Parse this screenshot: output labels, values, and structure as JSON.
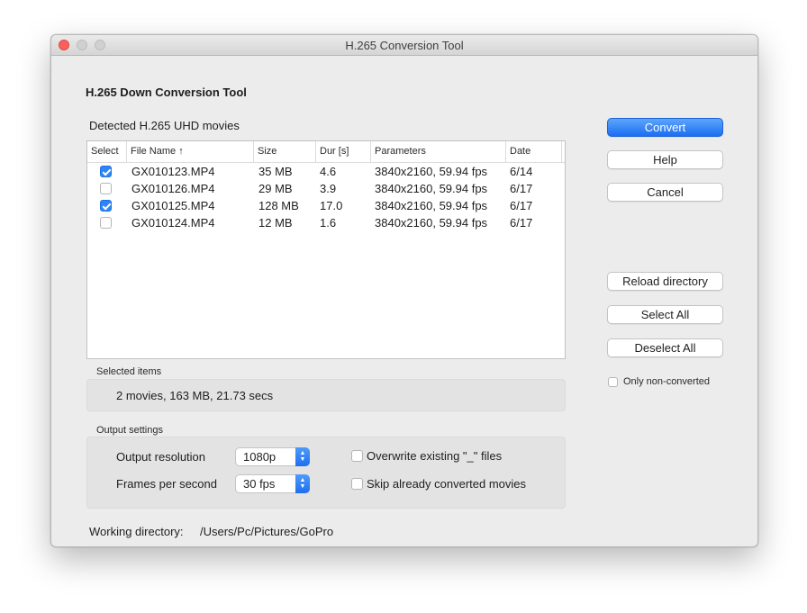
{
  "window": {
    "title": "H.265 Conversion Tool"
  },
  "app": {
    "heading": "H.265 Down Conversion Tool",
    "detected_label": "Detected H.265 UHD movies"
  },
  "table": {
    "columns": [
      "Select",
      "File Name",
      "Size",
      "Dur [s]",
      "Parameters",
      "Date"
    ],
    "sort_indicator": "↑",
    "rows": [
      {
        "selected": true,
        "file": "GX010123.MP4",
        "size": "35 MB",
        "dur": "4.6",
        "params": "3840x2160, 59.94 fps",
        "date": "6/14"
      },
      {
        "selected": false,
        "file": "GX010126.MP4",
        "size": "29 MB",
        "dur": "3.9",
        "params": "3840x2160, 59.94 fps",
        "date": "6/17"
      },
      {
        "selected": true,
        "file": "GX010125.MP4",
        "size": "128 MB",
        "dur": "17.0",
        "params": "3840x2160, 59.94 fps",
        "date": "6/17"
      },
      {
        "selected": false,
        "file": "GX010124.MP4",
        "size": "12 MB",
        "dur": "1.6",
        "params": "3840x2160, 59.94 fps",
        "date": "6/17"
      }
    ]
  },
  "selected_items": {
    "label": "Selected items",
    "summary": "2 movies, 163 MB, 21.73 secs"
  },
  "output": {
    "label": "Output settings",
    "resolution_label": "Output resolution",
    "resolution_value": "1080p",
    "fps_label": "Frames per second",
    "fps_value": "30 fps",
    "overwrite_label": "Overwrite existing \"_\" files",
    "overwrite_checked": false,
    "skip_label": "Skip already converted movies",
    "skip_checked": false
  },
  "working_dir": {
    "label": "Working directory:",
    "path": "/Users/Pc/Pictures/GoPro"
  },
  "buttons": {
    "convert": "Convert",
    "help": "Help",
    "cancel": "Cancel",
    "reload": "Reload directory",
    "select_all": "Select All",
    "deselect_all": "Deselect All"
  },
  "only_non_converted": {
    "label": "Only non-converted",
    "checked": false
  },
  "colors": {
    "accent": "#2d86f7",
    "close": "#fc605c"
  }
}
